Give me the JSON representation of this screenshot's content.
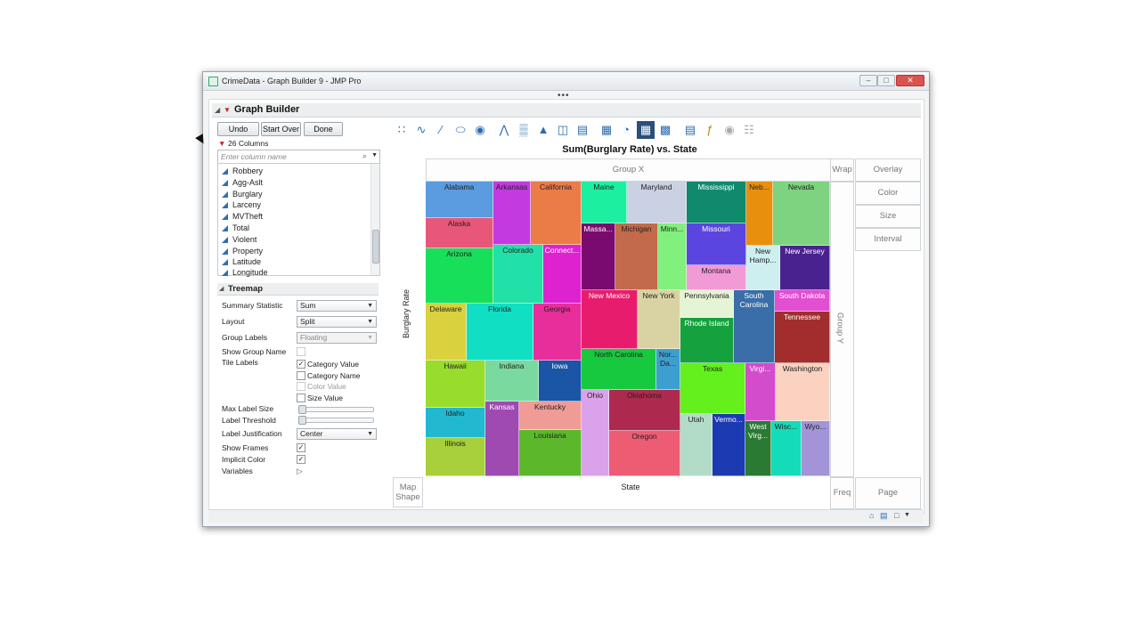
{
  "window": {
    "title": "CrimeData - Graph Builder 9 - JMP Pro",
    "dots": "•••"
  },
  "graph_builder": {
    "title": "Graph Builder",
    "buttons": {
      "undo": "Undo",
      "start_over": "Start Over",
      "done": "Done"
    },
    "columns_count": "26 Columns",
    "search_placeholder": "Enter column name",
    "columns": [
      "Robbery",
      "Agg-Aslt",
      "Burglary",
      "Larceny",
      "MVTheft",
      "Total",
      "Violent",
      "Property",
      "Latitude",
      "Longitude"
    ]
  },
  "treemap_panel": {
    "title": "Treemap",
    "summary_statistic": {
      "label": "Summary Statistic",
      "value": "Sum"
    },
    "layout": {
      "label": "Layout",
      "value": "Split"
    },
    "group_labels": {
      "label": "Group Labels",
      "value": "Floating"
    },
    "show_group_name": {
      "label": "Show Group Name",
      "checked": false
    },
    "tile_labels": {
      "label": "Tile Labels",
      "options": [
        {
          "label": "Category Value",
          "checked": true
        },
        {
          "label": "Category Name",
          "checked": false
        },
        {
          "label": "Color Value",
          "checked": false,
          "disabled": true
        },
        {
          "label": "Size Value",
          "checked": false
        }
      ]
    },
    "max_label_size": "Max Label Size",
    "label_threshold": "Label Threshold",
    "label_justification": {
      "label": "Label Justification",
      "value": "Center"
    },
    "show_frames": {
      "label": "Show Frames",
      "checked": true
    },
    "implicit_color": {
      "label": "Implicit Color",
      "checked": true
    },
    "variables": "Variables"
  },
  "toolbar": {
    "icons": [
      "points-icon",
      "smoother-icon",
      "line-of-fit-icon",
      "ellipse-icon",
      "contour-icon",
      "line-icon",
      "bar-icon",
      "area-icon",
      "box-plot-icon",
      "histogram-icon",
      "heatmap-icon",
      "pie-icon",
      "treemap-icon",
      "mosaic-icon",
      "caption-box-icon",
      "formula-icon",
      "map-shapes-icon",
      "parallel-icon"
    ],
    "selected": "treemap-icon"
  },
  "zones": {
    "group_x": "Group X",
    "wrap": "Wrap",
    "overlay": "Overlay",
    "color": "Color",
    "size": "Size",
    "interval": "Interval",
    "group_y": "Group Y",
    "map_shape": "Map\nShape",
    "freq": "Freq",
    "page": "Page"
  },
  "chart_data": {
    "type": "treemap",
    "title": "Sum(Burglary Rate) vs. State",
    "xlabel": "State",
    "ylabel": "Burglary Rate",
    "categories": [
      "Alabama",
      "Alaska",
      "Arizona",
      "Arkansas",
      "California",
      "Colorado",
      "Connecticut",
      "Maine",
      "Maryland",
      "Massachusetts",
      "Michigan",
      "Minnesota",
      "Mississippi",
      "Missouri",
      "Montana",
      "Nebraska",
      "Nevada",
      "New Hampshire",
      "New Jersey",
      "Delaware",
      "Florida",
      "Georgia",
      "New Mexico",
      "New York",
      "Pennsylvania",
      "Rhode Island",
      "South Carolina",
      "South Dakota",
      "Tennessee",
      "Hawaii",
      "Indiana",
      "Iowa",
      "Idaho",
      "Kansas",
      "Kentucky",
      "Louisiana",
      "Illinois",
      "North Carolina",
      "North Dakota",
      "Ohio",
      "Oklahoma",
      "Oregon",
      "Texas",
      "Utah",
      "Vermont",
      "Virginia",
      "Washington",
      "West Virginia",
      "Wisconsin",
      "Wyoming"
    ],
    "tile_labels": [
      "Alabama",
      "Alaska",
      "Arizona",
      "Arkansas",
      "California",
      "Colorado",
      "Connect...",
      "Maine",
      "Maryland",
      "Massa...",
      "Michigan",
      "Minn...",
      "Mississippi",
      "Missouri",
      "Montana",
      "Neb...",
      "Nevada",
      "New\nHamp...",
      "New Jersey",
      "Delaware",
      "Florida",
      "Georgia",
      "New Mexico",
      "New York",
      "Pennsylvania",
      "Rhode Island",
      "South\nCarolina",
      "South Dakota",
      "Tennessee",
      "Hawaii",
      "Indiana",
      "Iowa",
      "Idaho",
      "Kansas",
      "Kentucky",
      "Louisiana",
      "Illinois",
      "North Carolina",
      "Nor...\nDa...",
      "Ohio",
      "Oklahoma",
      "Oregon",
      "Texas",
      "Utah",
      "Vermo...",
      "Virgi...",
      "Washington",
      "West\nVirg...",
      "Wisc...",
      "Wyo..."
    ],
    "colors": [
      "#5b9be0",
      "#e8577a",
      "#17df5a",
      "#c33ae0",
      "#eb7c48",
      "#21e0a8",
      "#de22d0",
      "#1cf0a0",
      "#c9d1e2",
      "#7a0a6e",
      "#c26a4b",
      "#82f07c",
      "#0f8a6c",
      "#5a45e0",
      "#f29ad6",
      "#e8900e",
      "#7dd37f",
      "#cdeff0",
      "#4a2290",
      "#d9d23e",
      "#11dfc4",
      "#e72e9a",
      "#e81c6c",
      "#d9d3a4",
      "#e5f4d4",
      "#15a23e",
      "#3a6ea8",
      "#e24fd0",
      "#a12d2c",
      "#98dc2c",
      "#7ad99e",
      "#1a55a6",
      "#22b8d0",
      "#9f4ab0",
      "#ef9b96",
      "#5cb82a",
      "#a7d03a",
      "#17c93e",
      "#3c9fd0",
      "#daa2ea",
      "#ad2a4e",
      "#ee5c74",
      "#63f01c",
      "#b2dcc8",
      "#1c3ab2",
      "#d34ccc",
      "#fbd2c0",
      "#2a7a34",
      "#15dcb8",
      "#a394d9"
    ]
  }
}
